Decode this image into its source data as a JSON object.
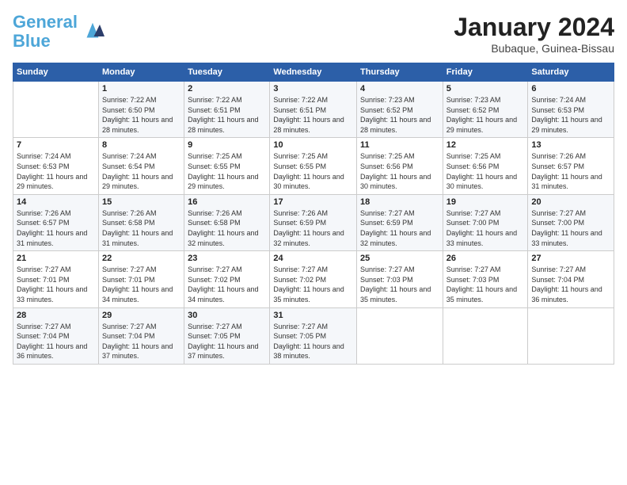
{
  "header": {
    "logo_line1": "General",
    "logo_line2": "Blue",
    "month_year": "January 2024",
    "location": "Bubaque, Guinea-Bissau"
  },
  "days_of_week": [
    "Sunday",
    "Monday",
    "Tuesday",
    "Wednesday",
    "Thursday",
    "Friday",
    "Saturday"
  ],
  "weeks": [
    [
      {
        "day": "",
        "sunrise": "",
        "sunset": "",
        "daylight": ""
      },
      {
        "day": "1",
        "sunrise": "7:22 AM",
        "sunset": "6:50 PM",
        "daylight": "11 hours and 28 minutes."
      },
      {
        "day": "2",
        "sunrise": "7:22 AM",
        "sunset": "6:51 PM",
        "daylight": "11 hours and 28 minutes."
      },
      {
        "day": "3",
        "sunrise": "7:22 AM",
        "sunset": "6:51 PM",
        "daylight": "11 hours and 28 minutes."
      },
      {
        "day": "4",
        "sunrise": "7:23 AM",
        "sunset": "6:52 PM",
        "daylight": "11 hours and 28 minutes."
      },
      {
        "day": "5",
        "sunrise": "7:23 AM",
        "sunset": "6:52 PM",
        "daylight": "11 hours and 29 minutes."
      },
      {
        "day": "6",
        "sunrise": "7:24 AM",
        "sunset": "6:53 PM",
        "daylight": "11 hours and 29 minutes."
      }
    ],
    [
      {
        "day": "7",
        "sunrise": "7:24 AM",
        "sunset": "6:53 PM",
        "daylight": "11 hours and 29 minutes."
      },
      {
        "day": "8",
        "sunrise": "7:24 AM",
        "sunset": "6:54 PM",
        "daylight": "11 hours and 29 minutes."
      },
      {
        "day": "9",
        "sunrise": "7:25 AM",
        "sunset": "6:55 PM",
        "daylight": "11 hours and 29 minutes."
      },
      {
        "day": "10",
        "sunrise": "7:25 AM",
        "sunset": "6:55 PM",
        "daylight": "11 hours and 30 minutes."
      },
      {
        "day": "11",
        "sunrise": "7:25 AM",
        "sunset": "6:56 PM",
        "daylight": "11 hours and 30 minutes."
      },
      {
        "day": "12",
        "sunrise": "7:25 AM",
        "sunset": "6:56 PM",
        "daylight": "11 hours and 30 minutes."
      },
      {
        "day": "13",
        "sunrise": "7:26 AM",
        "sunset": "6:57 PM",
        "daylight": "11 hours and 31 minutes."
      }
    ],
    [
      {
        "day": "14",
        "sunrise": "7:26 AM",
        "sunset": "6:57 PM",
        "daylight": "11 hours and 31 minutes."
      },
      {
        "day": "15",
        "sunrise": "7:26 AM",
        "sunset": "6:58 PM",
        "daylight": "11 hours and 31 minutes."
      },
      {
        "day": "16",
        "sunrise": "7:26 AM",
        "sunset": "6:58 PM",
        "daylight": "11 hours and 32 minutes."
      },
      {
        "day": "17",
        "sunrise": "7:26 AM",
        "sunset": "6:59 PM",
        "daylight": "11 hours and 32 minutes."
      },
      {
        "day": "18",
        "sunrise": "7:27 AM",
        "sunset": "6:59 PM",
        "daylight": "11 hours and 32 minutes."
      },
      {
        "day": "19",
        "sunrise": "7:27 AM",
        "sunset": "7:00 PM",
        "daylight": "11 hours and 33 minutes."
      },
      {
        "day": "20",
        "sunrise": "7:27 AM",
        "sunset": "7:00 PM",
        "daylight": "11 hours and 33 minutes."
      }
    ],
    [
      {
        "day": "21",
        "sunrise": "7:27 AM",
        "sunset": "7:01 PM",
        "daylight": "11 hours and 33 minutes."
      },
      {
        "day": "22",
        "sunrise": "7:27 AM",
        "sunset": "7:01 PM",
        "daylight": "11 hours and 34 minutes."
      },
      {
        "day": "23",
        "sunrise": "7:27 AM",
        "sunset": "7:02 PM",
        "daylight": "11 hours and 34 minutes."
      },
      {
        "day": "24",
        "sunrise": "7:27 AM",
        "sunset": "7:02 PM",
        "daylight": "11 hours and 35 minutes."
      },
      {
        "day": "25",
        "sunrise": "7:27 AM",
        "sunset": "7:03 PM",
        "daylight": "11 hours and 35 minutes."
      },
      {
        "day": "26",
        "sunrise": "7:27 AM",
        "sunset": "7:03 PM",
        "daylight": "11 hours and 35 minutes."
      },
      {
        "day": "27",
        "sunrise": "7:27 AM",
        "sunset": "7:04 PM",
        "daylight": "11 hours and 36 minutes."
      }
    ],
    [
      {
        "day": "28",
        "sunrise": "7:27 AM",
        "sunset": "7:04 PM",
        "daylight": "11 hours and 36 minutes."
      },
      {
        "day": "29",
        "sunrise": "7:27 AM",
        "sunset": "7:04 PM",
        "daylight": "11 hours and 37 minutes."
      },
      {
        "day": "30",
        "sunrise": "7:27 AM",
        "sunset": "7:05 PM",
        "daylight": "11 hours and 37 minutes."
      },
      {
        "day": "31",
        "sunrise": "7:27 AM",
        "sunset": "7:05 PM",
        "daylight": "11 hours and 38 minutes."
      },
      {
        "day": "",
        "sunrise": "",
        "sunset": "",
        "daylight": ""
      },
      {
        "day": "",
        "sunrise": "",
        "sunset": "",
        "daylight": ""
      },
      {
        "day": "",
        "sunrise": "",
        "sunset": "",
        "daylight": ""
      }
    ]
  ]
}
